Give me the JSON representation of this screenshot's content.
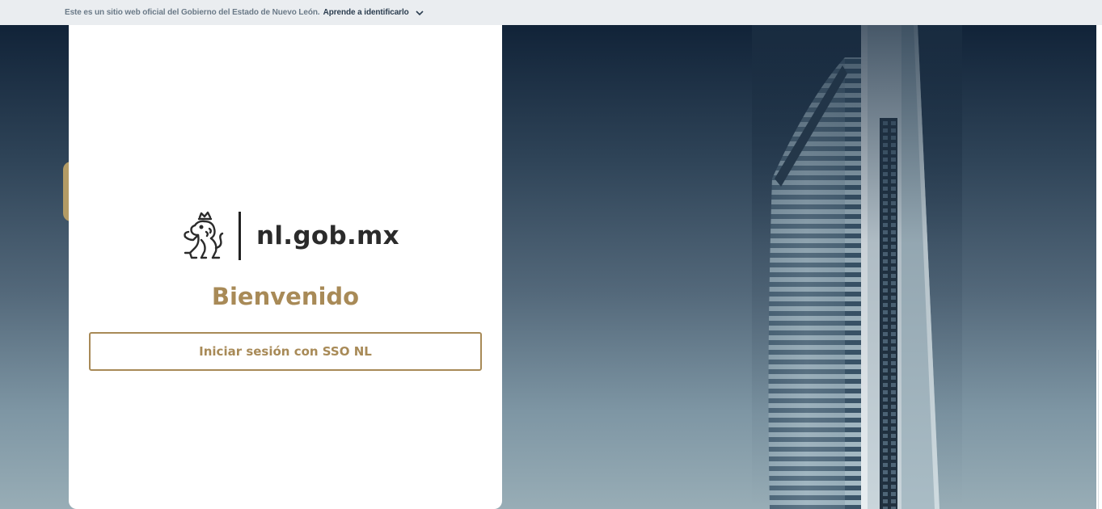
{
  "gov_banner": {
    "official_text": "Este es un sitio web oficial del Gobierno del Estado de Nuevo León.",
    "learn_link": "Aprende a identificarlo"
  },
  "logo": {
    "emblem_icon": "lion-crest-icon",
    "brand_text": "nl.gob.mx"
  },
  "login": {
    "welcome_title": "Bienvenido",
    "sso_button_label": "Iniciar sesión con SSO NL"
  },
  "colors": {
    "accent_gold": "#a88a57",
    "tab_gold": "#b39b65",
    "banner_bg": "#eaedf0",
    "hero_top": "#112338",
    "hero_bottom": "#98adb6"
  }
}
